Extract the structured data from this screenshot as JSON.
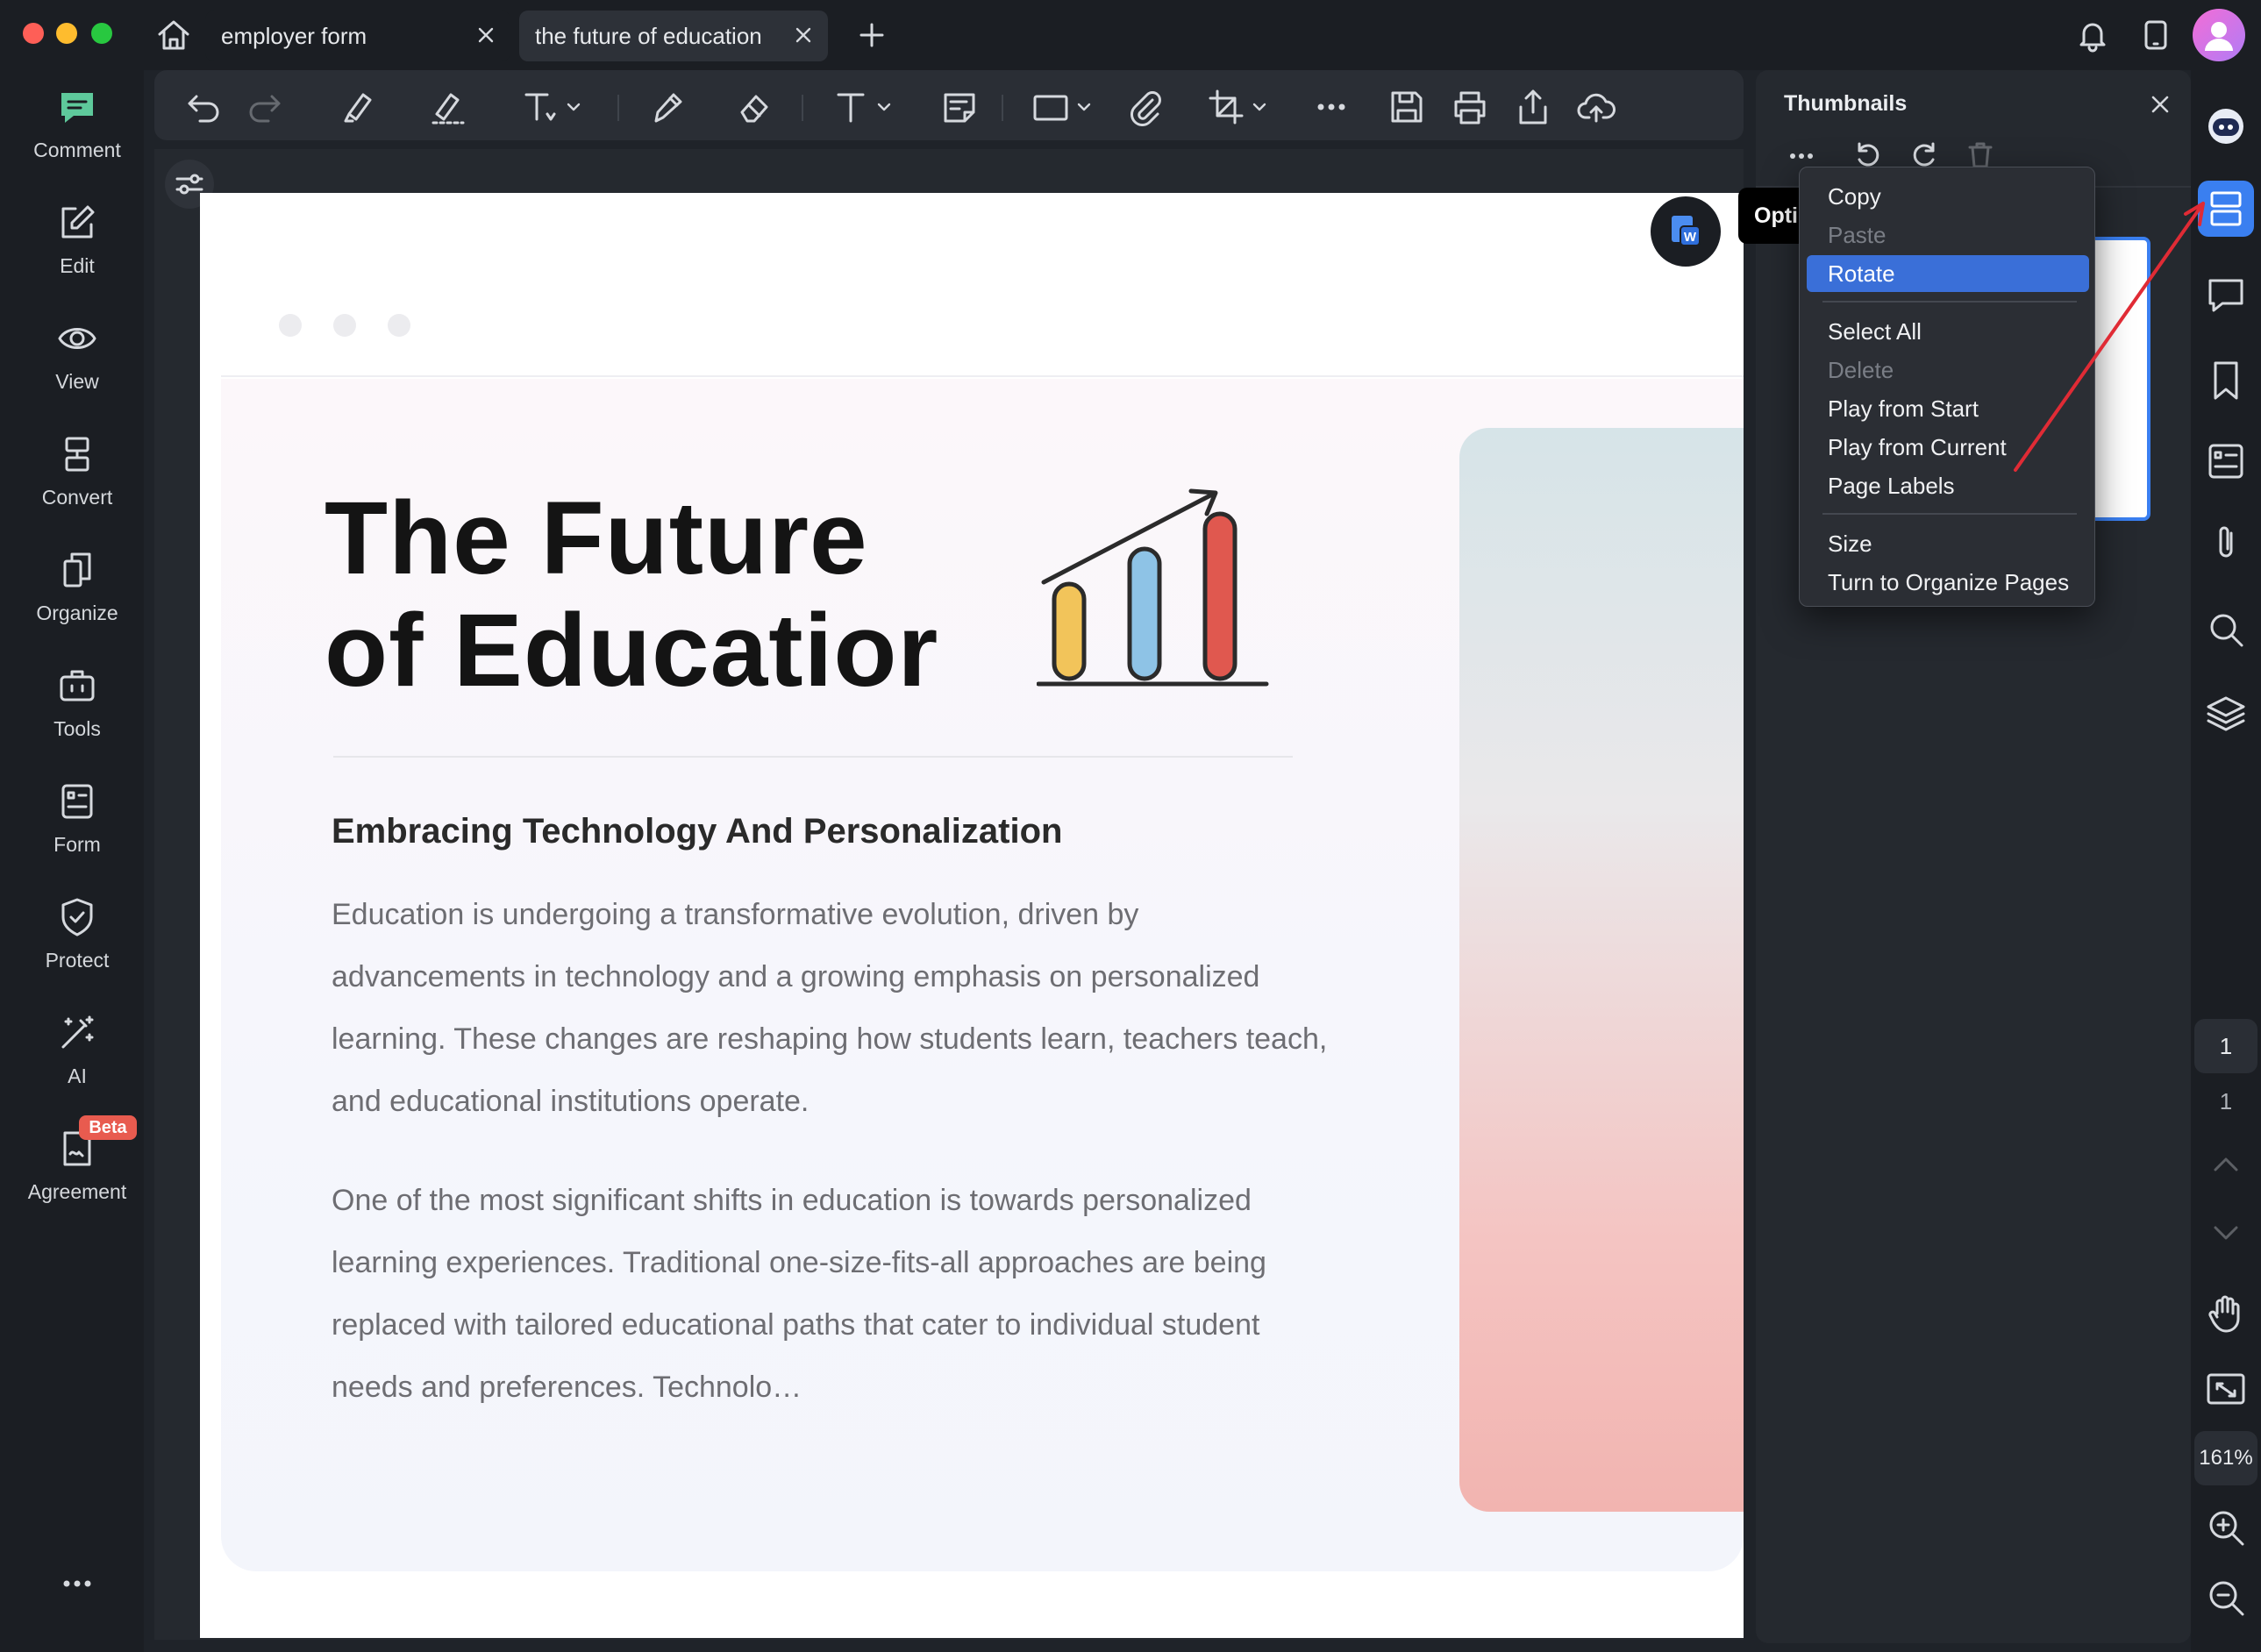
{
  "tabs": [
    {
      "label": "employer form"
    },
    {
      "label": "the future of education"
    }
  ],
  "left_sidebar": {
    "items": [
      {
        "label": "Comment",
        "icon": "comment-icon"
      },
      {
        "label": "Edit",
        "icon": "edit-icon"
      },
      {
        "label": "View",
        "icon": "eye-icon"
      },
      {
        "label": "Convert",
        "icon": "convert-icon"
      },
      {
        "label": "Organize",
        "icon": "organize-icon"
      },
      {
        "label": "Tools",
        "icon": "toolbox-icon"
      },
      {
        "label": "Form",
        "icon": "form-icon"
      },
      {
        "label": "Protect",
        "icon": "shield-icon"
      },
      {
        "label": "AI",
        "icon": "magic-wand-icon"
      },
      {
        "label": "Agreement",
        "icon": "agreement-icon",
        "badge": "Beta"
      }
    ]
  },
  "thumbnails": {
    "title": "Thumbnails"
  },
  "options_tooltip": "Opti",
  "context_menu": {
    "items": [
      {
        "label": "Copy",
        "state": "enabled"
      },
      {
        "label": "Paste",
        "state": "disabled"
      },
      {
        "label": "Rotate",
        "state": "active"
      },
      {
        "label": "Select All",
        "state": "enabled"
      },
      {
        "label": "Delete",
        "state": "disabled"
      },
      {
        "label": "Play from Start",
        "state": "enabled"
      },
      {
        "label": "Play from Current",
        "state": "enabled"
      },
      {
        "label": "Page Labels",
        "state": "enabled"
      },
      {
        "label": "Size",
        "state": "enabled"
      },
      {
        "label": "Turn to Organize Pages",
        "state": "enabled"
      }
    ]
  },
  "page_nav": {
    "current_page": "1",
    "total_pages": "1",
    "zoom": "161%"
  },
  "document": {
    "title": "The Future\nof Educatior",
    "subtitle": "Embracing Technology And Personalization",
    "paragraphs": [
      "Education is undergoing a transformative evolution, driven by advancements in technology and a growing emphasis on personalized learning. These changes are reshaping how students learn, teachers teach, and educational institutions operate.",
      "One of the most significant shifts in education is towards personalized learning experiences. Traditional one-size-fits-all approaches are being replaced with tailored educational paths that cater to individual student needs and preferences. Technolo…"
    ]
  },
  "colors": {
    "accent": "#3a6fd8",
    "bar_yellow": "#f2c45a",
    "bar_blue": "#8ec3e6",
    "bar_red": "#e0584f",
    "beta_badge": "#e85b4f",
    "annotation_arrow": "#e02b35"
  }
}
